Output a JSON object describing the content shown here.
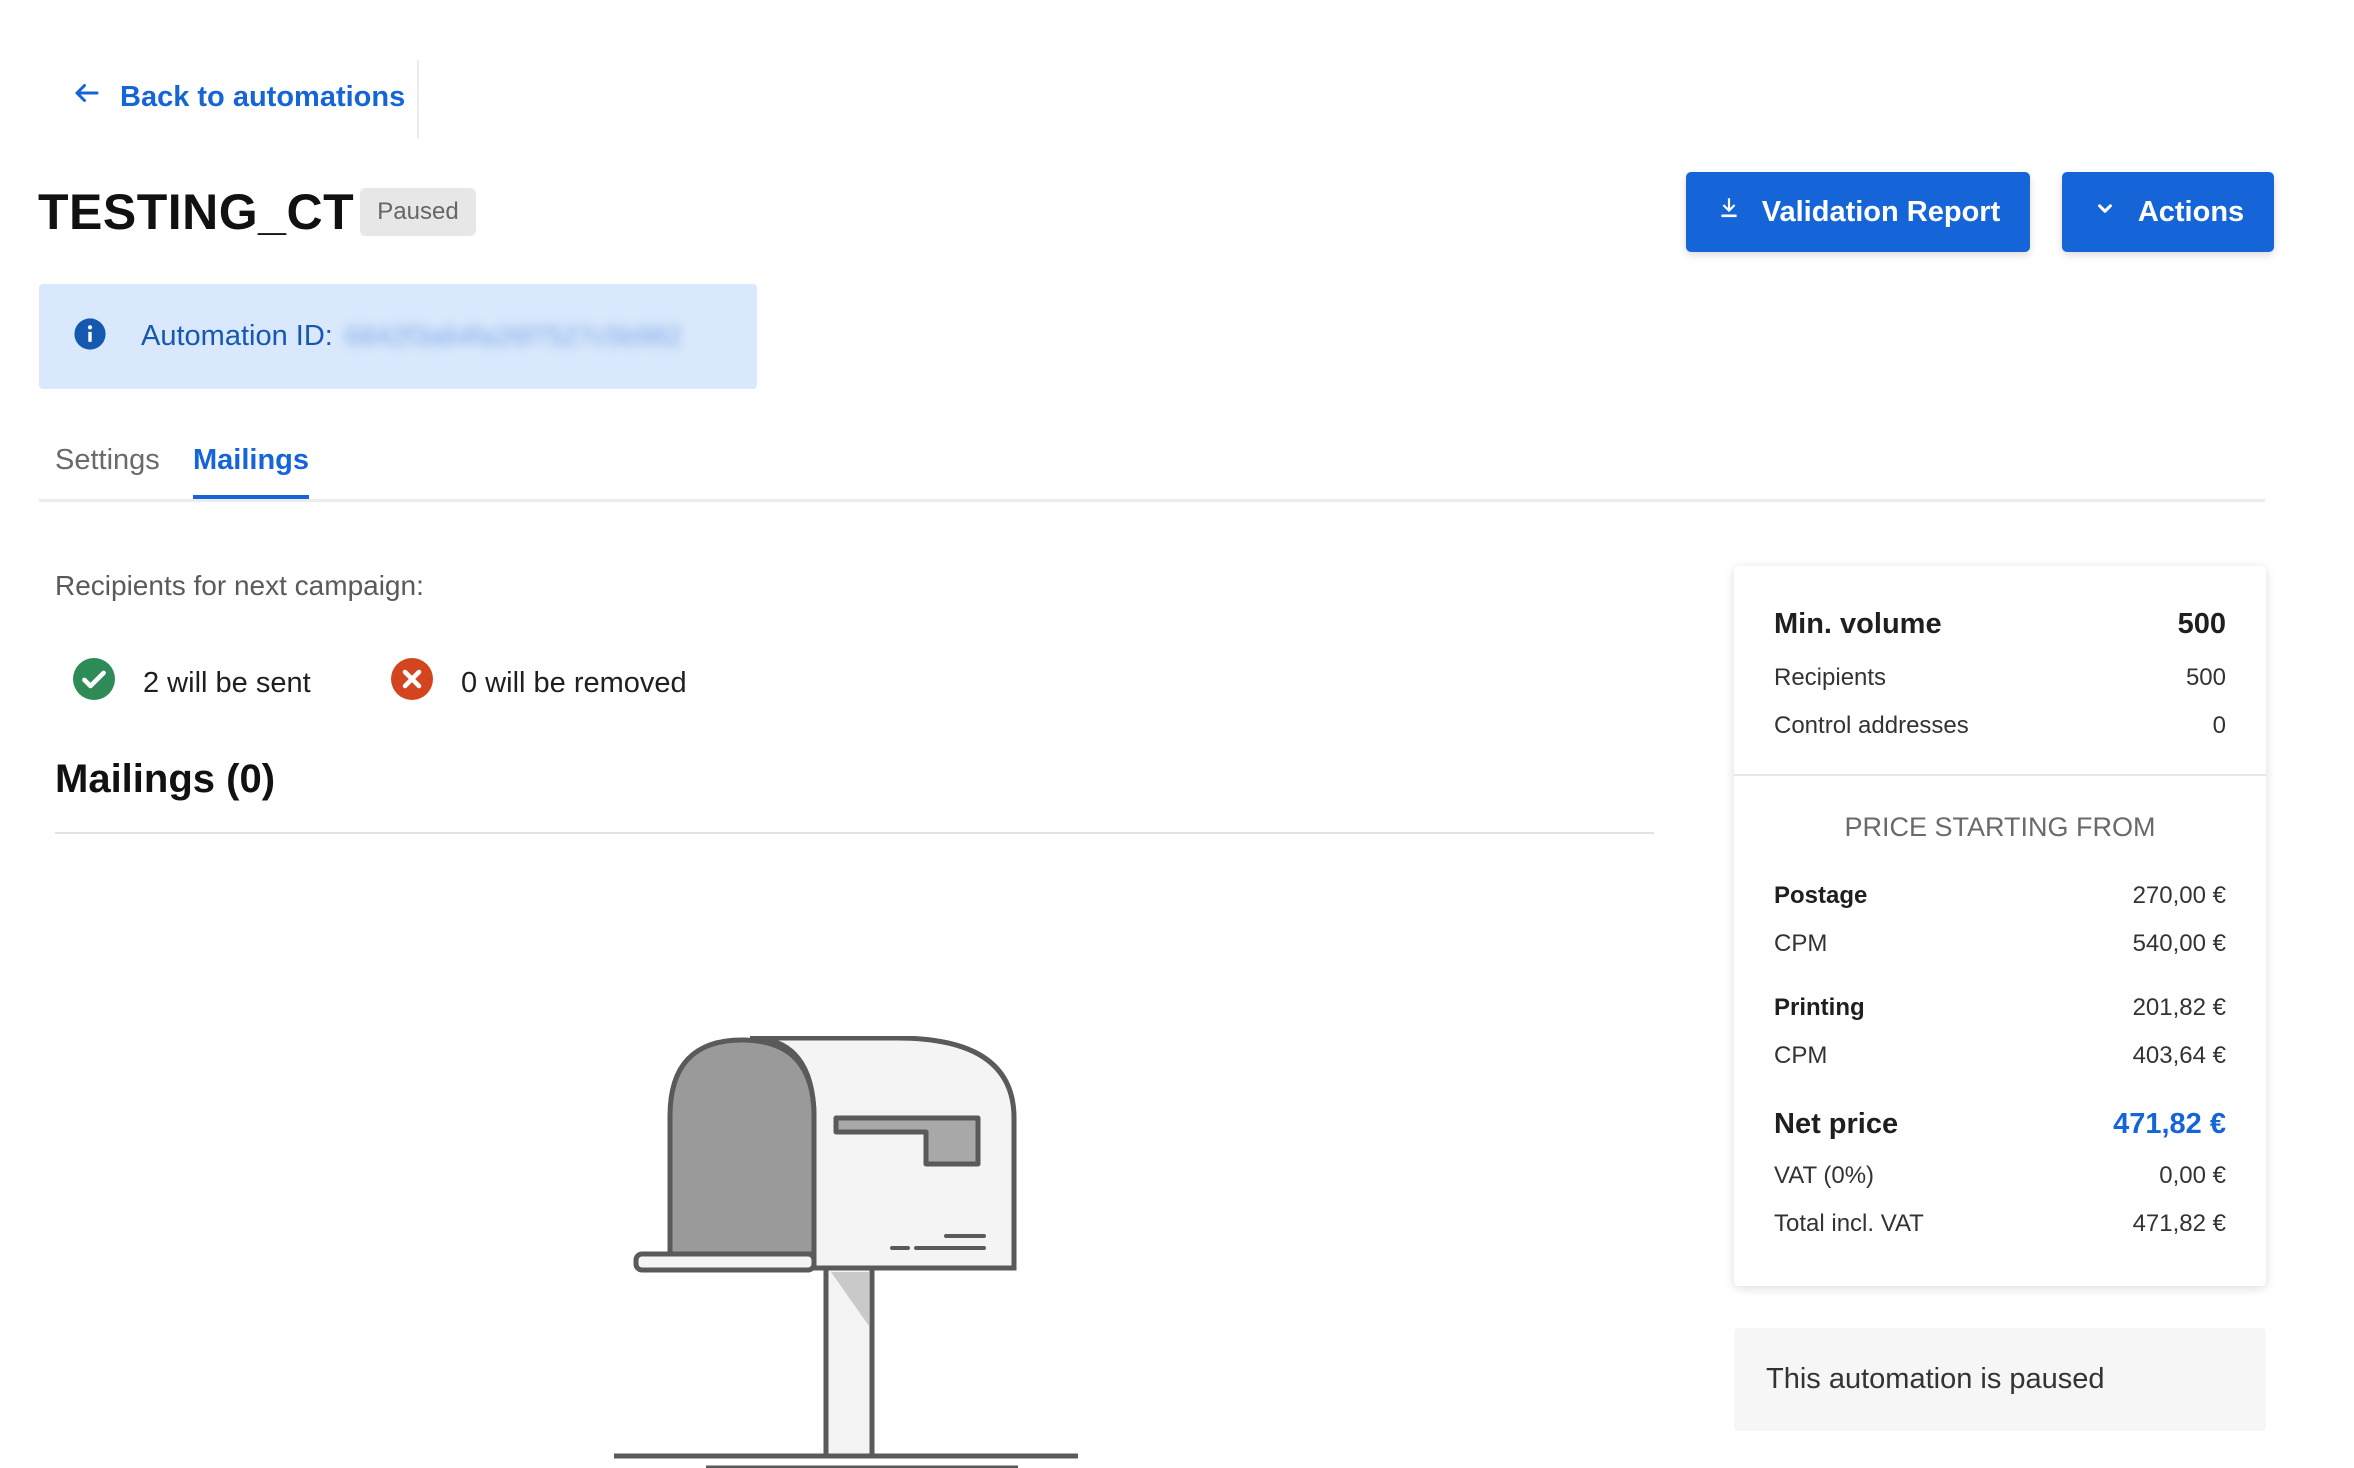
{
  "nav": {
    "back_label": "Back to automations"
  },
  "header": {
    "title": "TESTING_CT",
    "status": "Paused",
    "validation_button": "Validation Report",
    "actions_button": "Actions"
  },
  "info": {
    "label": "Automation ID:",
    "value": "6842f3a64fa26f7527c5b982"
  },
  "tabs": [
    {
      "label": "Settings",
      "active": false
    },
    {
      "label": "Mailings",
      "active": true
    }
  ],
  "recipients": {
    "label": "Recipients for next campaign:",
    "sent": "2 will be sent",
    "removed": "0 will be removed"
  },
  "mailings": {
    "heading": "Mailings (0)"
  },
  "pricing": {
    "min_volume": {
      "label": "Min. volume",
      "value": "500"
    },
    "recipients": {
      "label": "Recipients",
      "value": "500"
    },
    "control": {
      "label": "Control addresses",
      "value": "0"
    },
    "heading": "PRICE STARTING FROM",
    "postage": {
      "label": "Postage",
      "value": "270,00 €"
    },
    "postage_cpm": {
      "label": "CPM",
      "value": "540,00 €"
    },
    "printing": {
      "label": "Printing",
      "value": "201,82 €"
    },
    "printing_cpm": {
      "label": "CPM",
      "value": "403,64 €"
    },
    "net": {
      "label": "Net price",
      "value": "471,82 €"
    },
    "vat": {
      "label": "VAT (0%)",
      "value": "0,00 €"
    },
    "total": {
      "label": "Total incl. VAT",
      "value": "471,82 €"
    }
  },
  "paused_note": "This automation is paused",
  "colors": {
    "primary": "#1565d8",
    "info_bg": "#d9e8fc",
    "success": "#2e8b57",
    "danger": "#d2451e"
  }
}
